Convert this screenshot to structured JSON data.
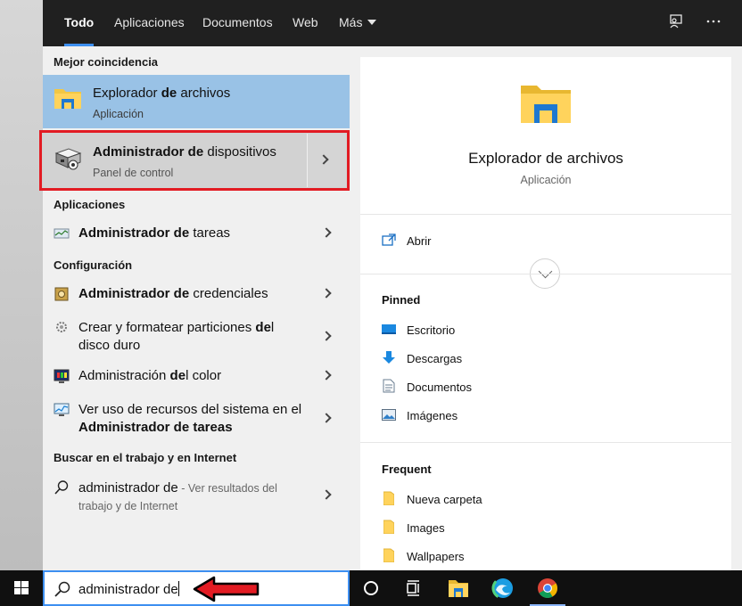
{
  "tabs": [
    {
      "label": "Todo",
      "active": true
    },
    {
      "label": "Aplicaciones"
    },
    {
      "label": "Documentos"
    },
    {
      "label": "Web"
    },
    {
      "label": "Más"
    }
  ],
  "top_icons": [
    "feedback-icon",
    "more-options-icon"
  ],
  "best_match": {
    "heading": "Mejor coincidencia",
    "item1": {
      "title_a": "Explorador ",
      "title_b": "de",
      "title_c": " archivos",
      "subtitle": "Aplicación",
      "icon": "folder-icon"
    },
    "item2": {
      "title_a": "Administrador de",
      "title_b": " dispositivos",
      "subtitle": "Panel de control",
      "icon": "device-manager-icon"
    }
  },
  "apps": {
    "heading": "Aplicaciones",
    "items": [
      {
        "bold": "Administrador de",
        "rest": " tareas",
        "icon": "task-manager-icon"
      }
    ]
  },
  "settings": {
    "heading": "Configuración",
    "items": [
      {
        "bold": "Administrador de",
        "rest": " credenciales",
        "icon": "credential-manager-icon"
      },
      {
        "line1a": "Crear y formatear particiones ",
        "line1b": "de",
        "line1c": "l",
        "line2": "disco duro",
        "icon": "partition-icon"
      },
      {
        "a": "Administración ",
        "b": "de",
        "c": "l color",
        "icon": "color-management-icon"
      },
      {
        "line1": "Ver uso de recursos del sistema en el",
        "line2": "Administrador de tareas",
        "icon": "resource-monitor-icon"
      }
    ]
  },
  "web": {
    "heading": "Buscar en el trabajo y en Internet",
    "query": "administrador de",
    "suffix": " - Ver resultados del",
    "line2": "trabajo y de Internet",
    "icon": "search-icon"
  },
  "preview": {
    "title": "Explorador de archivos",
    "subtitle": "Aplicación",
    "open_label": "Abrir",
    "pinned_heading": "Pinned",
    "pinned": [
      {
        "label": "Escritorio",
        "icon": "desktop-icon"
      },
      {
        "label": "Descargas",
        "icon": "download-icon"
      },
      {
        "label": "Documentos",
        "icon": "document-icon"
      },
      {
        "label": "Imágenes",
        "icon": "pictures-icon"
      }
    ],
    "frequent_heading": "Frequent",
    "frequent": [
      {
        "label": "Nueva carpeta",
        "icon": "folder-small-icon"
      },
      {
        "label": "Images",
        "icon": "folder-small-icon"
      },
      {
        "label": "Wallpapers",
        "icon": "folder-small-icon"
      }
    ]
  },
  "taskbar": {
    "search_text": "administrador de",
    "icons": [
      "windows-start-icon",
      "cortana-icon",
      "task-view-icon",
      "file-explorer-icon",
      "edge-icon",
      "chrome-icon"
    ]
  },
  "colors": {
    "accent": "#3d8ff0",
    "highlight": "#99c2e6",
    "annotation": "#e21b23"
  }
}
